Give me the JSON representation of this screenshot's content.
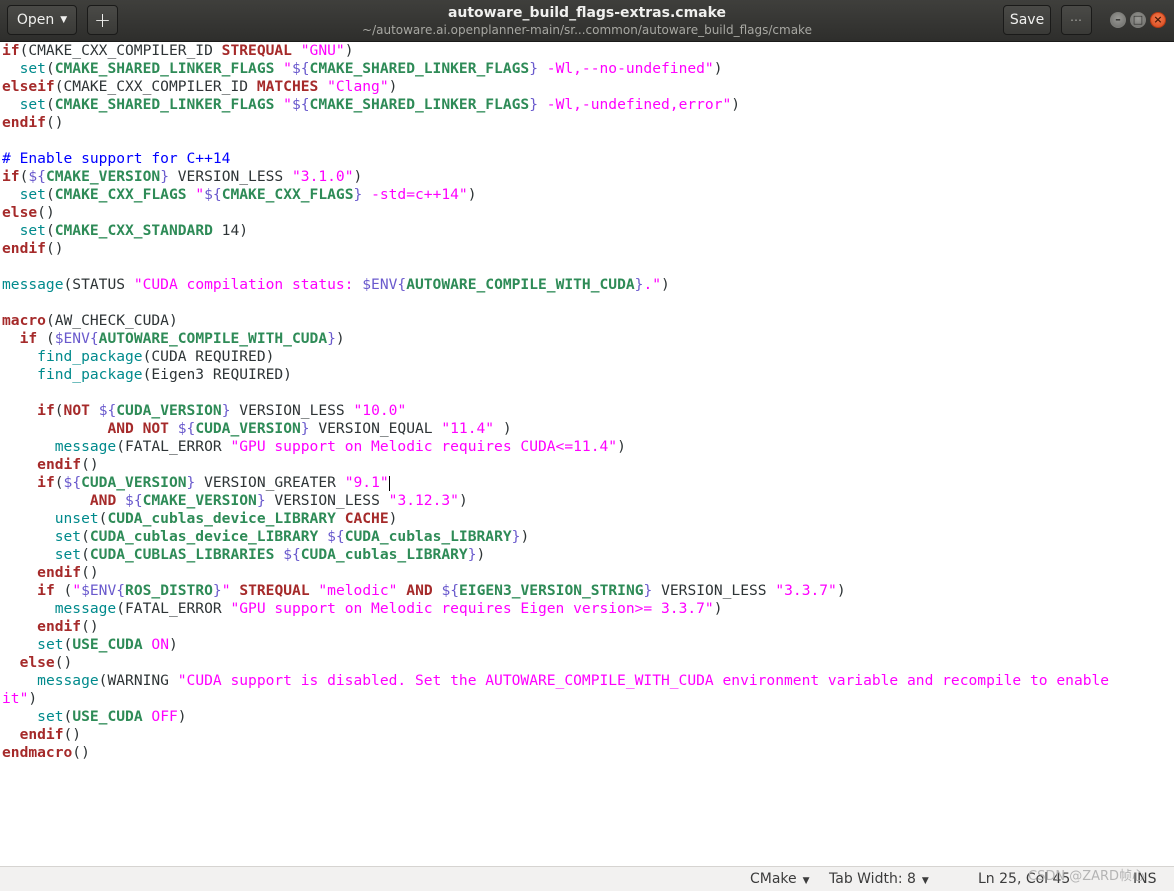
{
  "header": {
    "open_label": "Open",
    "new_tab_symbol": "+",
    "title": "autoware_build_flags-extras.cmake",
    "subtitle": "~/autoware.ai.openplanner-main/sr...common/autoware_build_flags/cmake",
    "save_label": "Save",
    "menu_symbol": "⋯",
    "window_controls": [
      "minimize",
      "maximize",
      "close"
    ]
  },
  "editor": {
    "lines": [
      [
        [
          "kw",
          "if"
        ],
        [
          "",
          "(CMAKE_CXX_COMPILER_ID "
        ],
        [
          "kw",
          "STREQUAL"
        ],
        [
          "",
          ""
        ],
        [
          "str",
          " \"GNU\""
        ],
        [
          "",
          ")"
        ]
      ],
      [
        [
          "",
          "  "
        ],
        [
          "fn",
          "set"
        ],
        [
          "",
          "("
        ],
        [
          "var",
          "CMAKE_SHARED_LINKER_FLAGS"
        ],
        [
          "str",
          " \""
        ],
        [
          "dl",
          "${"
        ],
        [
          "var",
          "CMAKE_SHARED_LINKER_FLAGS"
        ],
        [
          "dl",
          "}"
        ],
        [
          "str",
          " -Wl,--no-undefined\""
        ],
        [
          "",
          ")"
        ]
      ],
      [
        [
          "kw",
          "elseif"
        ],
        [
          "",
          "(CMAKE_CXX_COMPILER_ID "
        ],
        [
          "kw",
          "MATCHES"
        ],
        [
          "str",
          " \"Clang\""
        ],
        [
          "",
          ")"
        ]
      ],
      [
        [
          "",
          "  "
        ],
        [
          "fn",
          "set"
        ],
        [
          "",
          "("
        ],
        [
          "var",
          "CMAKE_SHARED_LINKER_FLAGS"
        ],
        [
          "str",
          " \""
        ],
        [
          "dl",
          "${"
        ],
        [
          "var",
          "CMAKE_SHARED_LINKER_FLAGS"
        ],
        [
          "dl",
          "}"
        ],
        [
          "str",
          " -Wl,-undefined,error\""
        ],
        [
          "",
          ")"
        ]
      ],
      [
        [
          "kw",
          "endif"
        ],
        [
          "",
          "()"
        ]
      ],
      [],
      [
        [
          "cm",
          "# Enable support for C++14"
        ]
      ],
      [
        [
          "kw",
          "if"
        ],
        [
          "",
          "("
        ],
        [
          "dl",
          "${"
        ],
        [
          "var",
          "CMAKE_VERSION"
        ],
        [
          "dl",
          "}"
        ],
        [
          "",
          ""
        ],
        [
          "",
          "  VERSION_LESS "
        ],
        [
          "str",
          "\"3.1.0\""
        ],
        [
          "",
          ")"
        ]
      ],
      [
        [
          "",
          "  "
        ],
        [
          "fn",
          "set"
        ],
        [
          "",
          "("
        ],
        [
          "var",
          "CMAKE_CXX_FLAGS"
        ],
        [
          "str",
          " \""
        ],
        [
          "dl",
          "${"
        ],
        [
          "var",
          "CMAKE_CXX_FLAGS"
        ],
        [
          "dl",
          "}"
        ],
        [
          "str",
          " -std=c++14\""
        ],
        [
          "",
          ")"
        ]
      ],
      [
        [
          "kw",
          "else"
        ],
        [
          "",
          "()"
        ]
      ],
      [
        [
          "",
          "  "
        ],
        [
          "fn",
          "set"
        ],
        [
          "",
          "("
        ],
        [
          "var",
          "CMAKE_CXX_STANDARD"
        ],
        [
          "",
          ""
        ],
        [
          "",
          ""
        ],
        [
          "",
          "  14)"
        ]
      ],
      [
        [
          "kw",
          "endif"
        ],
        [
          "",
          "()"
        ]
      ],
      [],
      [
        [
          "fn",
          "message"
        ],
        [
          "",
          "(STATUS "
        ],
        [
          "str",
          "\"CUDA compilation status: "
        ],
        [
          "dl",
          "$ENV{"
        ],
        [
          "var",
          "AUTOWARE_COMPILE_WITH_CUDA"
        ],
        [
          "dl",
          "}"
        ],
        [
          "str",
          ".\""
        ],
        [
          "",
          ")"
        ]
      ],
      [],
      [
        [
          "kw",
          "macro"
        ],
        [
          "",
          "(AW_CHECK_CUDA)"
        ]
      ],
      [
        [
          "",
          "  "
        ],
        [
          "kw",
          "if"
        ],
        [
          "",
          ""
        ],
        [
          "",
          ""
        ],
        [
          "",
          "  ("
        ],
        [
          "dl",
          "$ENV{"
        ],
        [
          "var",
          "AUTOWARE_COMPILE_WITH_CUDA"
        ],
        [
          "dl",
          "}"
        ],
        [
          "",
          ")"
        ]
      ],
      [
        [
          "",
          "    "
        ],
        [
          "fn",
          "find_package"
        ],
        [
          "",
          "(CUDA REQUIRED)"
        ]
      ],
      [
        [
          "",
          "    "
        ],
        [
          "fn",
          "find_package"
        ],
        [
          "",
          "(Eigen3 REQUIRED)"
        ]
      ],
      [],
      [
        [
          "",
          "    "
        ],
        [
          "kw",
          "if"
        ],
        [
          "",
          "("
        ],
        [
          "kw",
          "NOT"
        ],
        [
          "",
          ""
        ],
        [
          "",
          ""
        ],
        [
          "",
          "  "
        ],
        [
          "dl",
          "${"
        ],
        [
          "var",
          "CUDA_VERSION"
        ],
        [
          "dl",
          "}"
        ],
        [
          "",
          ""
        ],
        [
          "",
          "  VERSION_LESS "
        ],
        [
          "str",
          "\"10.0\""
        ]
      ],
      [
        [
          "",
          "            "
        ],
        [
          "kw",
          "AND NOT"
        ],
        [
          "",
          ""
        ],
        [
          "",
          ""
        ],
        [
          "",
          "  "
        ],
        [
          "dl",
          "${"
        ],
        [
          "var",
          "CUDA_VERSION"
        ],
        [
          "dl",
          "}"
        ],
        [
          "",
          ""
        ],
        [
          "",
          "  VERSION_EQUAL "
        ],
        [
          "str",
          "\"11.4\""
        ],
        [
          "",
          ""
        ],
        [
          "",
          "  )"
        ]
      ],
      [
        [
          "",
          "      "
        ],
        [
          "fn",
          "message"
        ],
        [
          "",
          "(FATAL_ERROR "
        ],
        [
          "str",
          "\"GPU support on Melodic requires CUDA<=11.4\""
        ],
        [
          "",
          ")"
        ]
      ],
      [
        [
          "",
          "    "
        ],
        [
          "kw",
          "endif"
        ],
        [
          "",
          "()"
        ]
      ],
      [
        [
          "",
          "    "
        ],
        [
          "kw",
          "if"
        ],
        [
          "",
          "("
        ],
        [
          "dl",
          "${"
        ],
        [
          "var",
          "CUDA_VERSION"
        ],
        [
          "dl",
          "}"
        ],
        [
          "",
          ""
        ],
        [
          "",
          "  VERSION_GREATER "
        ],
        [
          "str",
          "\"9.1\""
        ],
        [
          "cursor",
          ""
        ]
      ],
      [
        [
          "",
          "          "
        ],
        [
          "kw",
          "AND"
        ],
        [
          "",
          ""
        ],
        [
          "",
          "  "
        ],
        [
          "dl",
          "${"
        ],
        [
          "var",
          "CMAKE_VERSION"
        ],
        [
          "dl",
          "}"
        ],
        [
          "",
          ""
        ],
        [
          "",
          "  VERSION_LESS "
        ],
        [
          "str",
          "\"3.12.3\""
        ],
        [
          "",
          ")"
        ]
      ],
      [
        [
          "",
          "      "
        ],
        [
          "fn",
          "unset"
        ],
        [
          "",
          "("
        ],
        [
          "var",
          "CUDA_cublas_device_LIBRARY"
        ],
        [
          "",
          ""
        ],
        [
          "",
          ""
        ],
        [
          "",
          "  "
        ],
        [
          "kw",
          "CACHE"
        ],
        [
          "",
          ")"
        ]
      ],
      [
        [
          "",
          "      "
        ],
        [
          "fn",
          "set"
        ],
        [
          "",
          "("
        ],
        [
          "var",
          "CUDA_cublas_device_LIBRARY"
        ],
        [
          "",
          ""
        ],
        [
          "",
          ""
        ],
        [
          "",
          "  "
        ],
        [
          "dl",
          "${"
        ],
        [
          "var",
          "CUDA_cublas_LIBRARY"
        ],
        [
          "dl",
          "}"
        ],
        [
          "",
          ")"
        ]
      ],
      [
        [
          "",
          "      "
        ],
        [
          "fn",
          "set"
        ],
        [
          "",
          "("
        ],
        [
          "var",
          "CUDA_CUBLAS_LIBRARIES"
        ],
        [
          "",
          ""
        ],
        [
          "",
          ""
        ],
        [
          "",
          "  "
        ],
        [
          "dl",
          "${"
        ],
        [
          "var",
          "CUDA_cublas_LIBRARY"
        ],
        [
          "dl",
          "}"
        ],
        [
          "",
          ")"
        ]
      ],
      [
        [
          "",
          "    "
        ],
        [
          "kw",
          "endif"
        ],
        [
          "",
          "()"
        ]
      ],
      [
        [
          "",
          "    "
        ],
        [
          "kw",
          "if"
        ],
        [
          "",
          ""
        ],
        [
          "",
          ""
        ],
        [
          "",
          "  ("
        ],
        [
          "str",
          "\""
        ],
        [
          "dl",
          "$ENV{"
        ],
        [
          "var",
          "ROS_DISTRO"
        ],
        [
          "dl",
          "}"
        ],
        [
          "str",
          "\""
        ],
        [
          "",
          ""
        ],
        [
          "",
          "  "
        ],
        [
          "kw",
          "STREQUAL"
        ],
        [
          "str",
          " \"melodic\""
        ],
        [
          "",
          ""
        ],
        [
          "",
          "  "
        ],
        [
          "kw",
          "AND"
        ],
        [
          "",
          ""
        ],
        [
          "",
          "  "
        ],
        [
          "dl",
          "${"
        ],
        [
          "var",
          "EIGEN3_VERSION_STRING"
        ],
        [
          "dl",
          "}"
        ],
        [
          "",
          ""
        ],
        [
          "",
          "  VERSION_LESS "
        ],
        [
          "str",
          "\"3.3.7\""
        ],
        [
          "",
          ")"
        ]
      ],
      [
        [
          "",
          "      "
        ],
        [
          "fn",
          "message"
        ],
        [
          "",
          "(FATAL_ERROR "
        ],
        [
          "str",
          "\"GPU support on Melodic requires Eigen version>= 3.3.7\""
        ],
        [
          "",
          ")"
        ]
      ],
      [
        [
          "",
          "    "
        ],
        [
          "kw",
          "endif"
        ],
        [
          "",
          "()"
        ]
      ],
      [
        [
          "",
          "    "
        ],
        [
          "fn",
          "set"
        ],
        [
          "",
          "("
        ],
        [
          "var",
          "USE_CUDA"
        ],
        [
          "",
          ""
        ],
        [
          "",
          ""
        ],
        [
          "",
          "  "
        ],
        [
          "str",
          "ON"
        ],
        [
          "",
          ")"
        ]
      ],
      [
        [
          "",
          "  "
        ],
        [
          "kw",
          "else"
        ],
        [
          "",
          "()"
        ]
      ],
      [
        [
          "",
          "    "
        ],
        [
          "fn",
          "message"
        ],
        [
          "",
          "(WARNING "
        ],
        [
          "str",
          "\"CUDA support is disabled. Set the AUTOWARE_COMPILE_WITH_CUDA environment variable and recompile to enable"
        ]
      ],
      [
        [
          "str",
          "it\""
        ],
        [
          "",
          ")"
        ]
      ],
      [
        [
          "",
          "    "
        ],
        [
          "fn",
          "set"
        ],
        [
          "",
          "("
        ],
        [
          "var",
          "USE_CUDA"
        ],
        [
          "",
          ""
        ],
        [
          "",
          ""
        ],
        [
          "",
          "  "
        ],
        [
          "str",
          "OFF"
        ],
        [
          "",
          ")"
        ]
      ],
      [
        [
          "",
          "  "
        ],
        [
          "kw",
          "endif"
        ],
        [
          "",
          "()"
        ]
      ],
      [
        [
          "kw",
          "endmacro"
        ],
        [
          "",
          "()"
        ]
      ]
    ]
  },
  "statusbar": {
    "language": "CMake",
    "tab_width": "Tab Width: 8",
    "position": "Ln 25, Col 45",
    "mode": "INS",
    "watermark": "CSDN @ZARD帧心"
  },
  "colors": {
    "keyword": "#a52a2a",
    "function": "#008a8c",
    "variable": "#2e8b57",
    "string": "#ff00ff",
    "comment": "#0000ff",
    "header_bg": "#353533",
    "statusbar_bg": "#f2f1f0"
  }
}
